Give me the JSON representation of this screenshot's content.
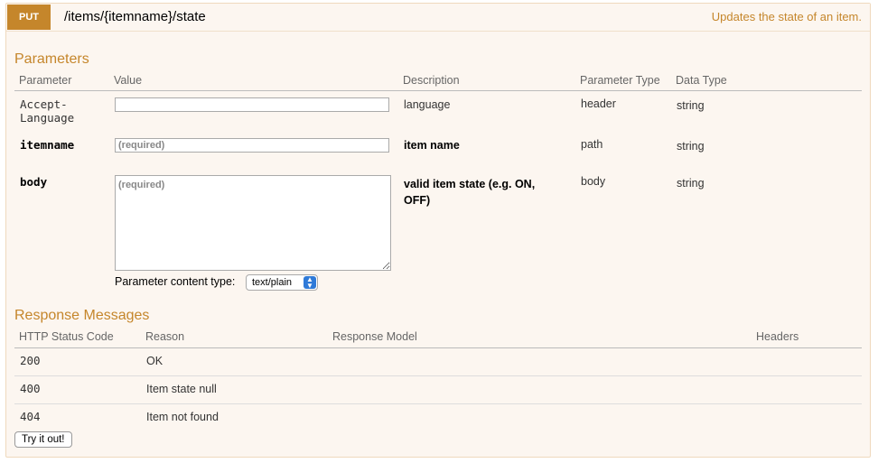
{
  "operation": {
    "method": "PUT",
    "path": "/items/{itemname}/state",
    "summary": "Updates the state of an item."
  },
  "parameters": {
    "title": "Parameters",
    "headers": [
      "Parameter",
      "Value",
      "Description",
      "Parameter Type",
      "Data Type"
    ],
    "rows": [
      {
        "name_line1": "Accept-",
        "name_line2": "Language",
        "value": "",
        "placeholder": "",
        "description": "language",
        "param_type": "header",
        "data_type": "string"
      },
      {
        "name": "itemname",
        "value": "",
        "placeholder": "(required)",
        "description": "item name",
        "param_type": "path",
        "data_type": "string"
      },
      {
        "name": "body",
        "value": "",
        "placeholder": "(required)",
        "description_line1": "valid item state (e.g. ON,",
        "description_line2": "OFF)",
        "param_type": "body",
        "data_type": "string"
      }
    ],
    "content_type_label": "Parameter content type:",
    "content_type_value": "text/plain"
  },
  "responses": {
    "title": "Response Messages",
    "headers": [
      "HTTP Status Code",
      "Reason",
      "Response Model",
      "Headers"
    ],
    "rows": [
      {
        "code": "200",
        "reason": "OK"
      },
      {
        "code": "400",
        "reason": "Item state null"
      },
      {
        "code": "404",
        "reason": "Item not found"
      }
    ]
  },
  "try_button": "Try it out!",
  "colors": {
    "accent": "#c5862b",
    "panel_bg": "#fcf6f0",
    "chevron": "#2f7ad8"
  },
  "icons": {
    "select_chevron": "chevron-up-down-icon"
  }
}
